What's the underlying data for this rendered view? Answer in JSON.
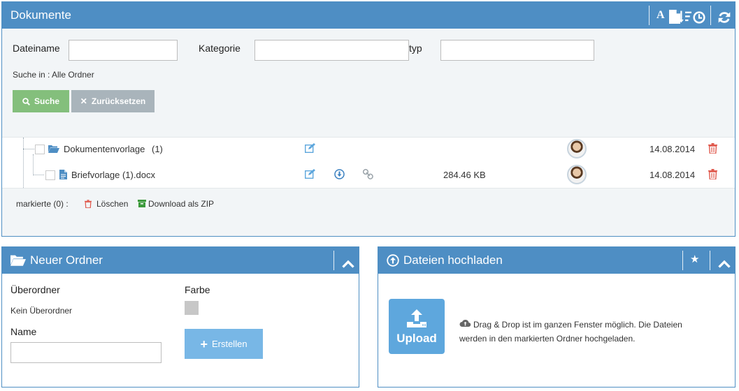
{
  "documents": {
    "title": "Dokumente",
    "header_icons": [
      "font-icon",
      "file-icon",
      "sort-icon",
      "clock-icon",
      "refresh-icon"
    ],
    "filename_label": "Dateiname",
    "filename_value": "",
    "category_label": "Kategorie",
    "category_value": "",
    "type_label": "typ",
    "type_value": "",
    "search_in_label": "Suche in :",
    "search_in_link": "Alle Ordner",
    "search_button": "Suche",
    "reset_button": "Zurücksetzen",
    "rows": [
      {
        "name": "Dokumentenvorlage",
        "count": "(1)",
        "size": "",
        "date": "14.08.2014"
      },
      {
        "name": "Briefvorlage (1).docx",
        "count": "",
        "size": "284.46 KB",
        "date": "14.08.2014"
      }
    ],
    "marked_label": "markierte (0) :",
    "delete_label": "Löschen",
    "zip_label": "Download als ZIP"
  },
  "new_folder": {
    "title": "Neuer Ordner",
    "parent_label": "Überordner",
    "parent_value": "Kein Überordner",
    "color_label": "Farbe",
    "color_value": "#c7c7c7",
    "name_label": "Name",
    "name_value": "",
    "create_button": "Erstellen"
  },
  "upload": {
    "title": "Dateien hochladen",
    "upload_button": "Upload",
    "info_line1": "Drag & Drop ist im ganzen Fenster möglich. Die Dateien",
    "info_line2": "werden in den markierten Ordner hochgeladen."
  },
  "colors": {
    "header_blue": "#4e8ec4",
    "search_green": "#84bf7c",
    "reset_grey": "#a9b4bb",
    "create_blue": "#78b7e6",
    "upload_blue": "#5ea7dd",
    "delete_red": "#e05a4e",
    "link_blue": "#3b81c1"
  }
}
